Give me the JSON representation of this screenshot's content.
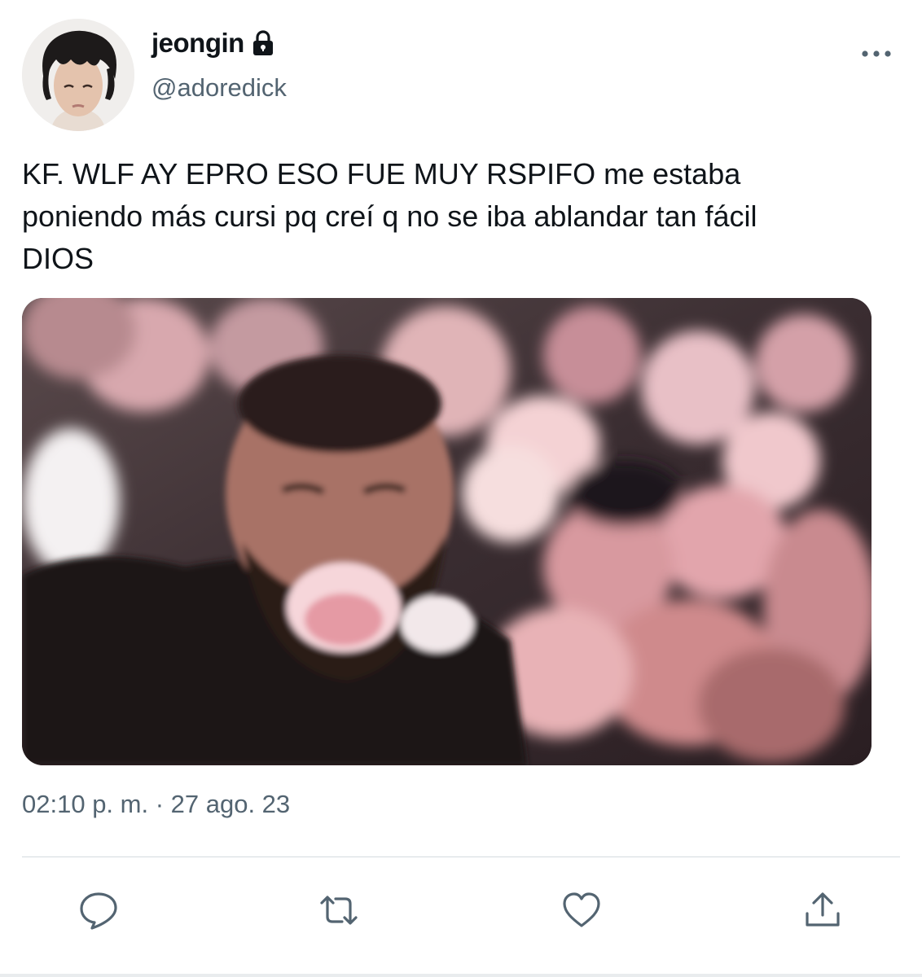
{
  "user": {
    "display_name": "jeongin",
    "handle": "@adoredick",
    "avatar_icon": "profile-photo",
    "protected_icon": "lock-icon"
  },
  "menu": {
    "more_icon": "more-horizontal-icon"
  },
  "tweet": {
    "text": "KF. WLF AY EPRO ESO FUE MUY RSPIFO me estaba\nponiendo más cursi pq creí q no se iba ablandar tan fácil\nDIOS",
    "timestamp": "02:10 p. m. · 27 ago. 23"
  },
  "actions": [
    {
      "name": "reply",
      "icon": "reply-icon"
    },
    {
      "name": "retweet",
      "icon": "retweet-icon"
    },
    {
      "name": "like",
      "icon": "heart-icon"
    },
    {
      "name": "share",
      "icon": "share-icon"
    }
  ],
  "colors": {
    "text_primary": "#0f1419",
    "text_secondary": "#536471",
    "divider": "#d4dadf"
  }
}
